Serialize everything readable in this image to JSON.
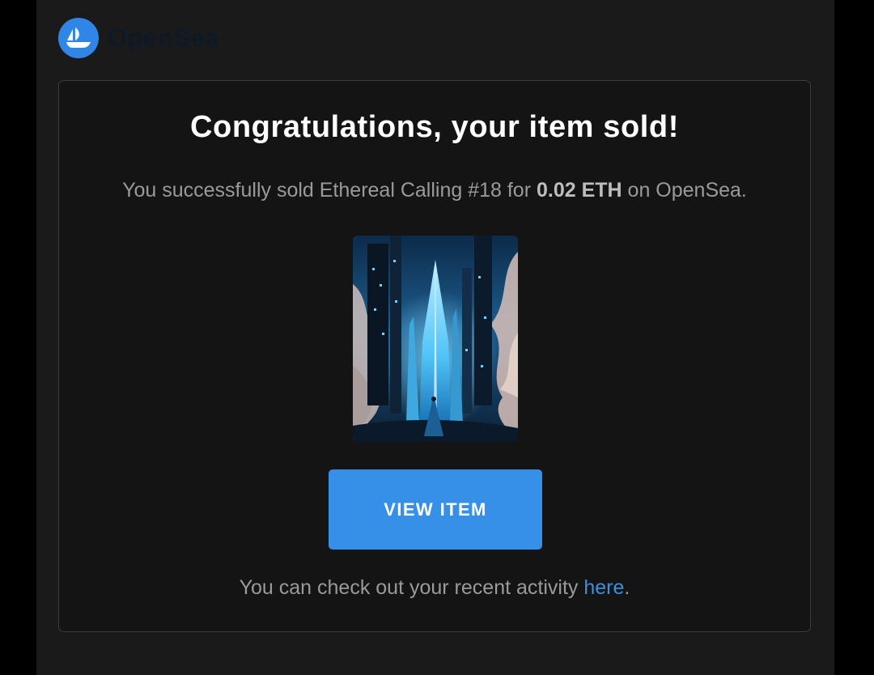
{
  "header": {
    "brand_name": "OpenSea",
    "logo_icon": "sailboat-icon"
  },
  "card": {
    "title": "Congratulations, your item sold!",
    "summary": {
      "prefix": "You successfully sold Ethereal Calling #18 for ",
      "price": "0.02 ETH",
      "suffix": " on OpenSea."
    },
    "image": {
      "alt": "Ethereal Calling #18",
      "icon": "nft-artwork-image"
    },
    "view_button_label": "VIEW ITEM",
    "activity": {
      "prefix": "You can check out your recent activity ",
      "link_label": "here",
      "suffix": "."
    }
  },
  "colors": {
    "accent": "#3690e8",
    "link": "#3a8fe0",
    "logo_badge": "#2f86e6",
    "background": "#1a1a1a",
    "card_background": "#141414"
  }
}
